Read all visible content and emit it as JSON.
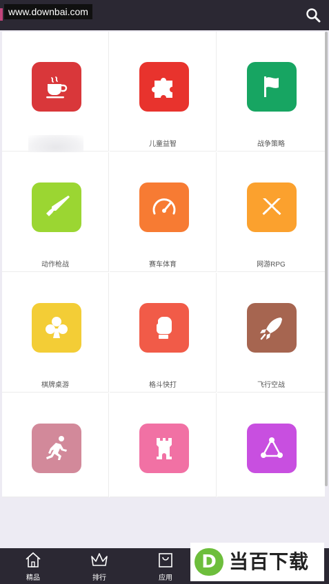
{
  "header": {
    "watermark": "www.downbai.com",
    "search_icon": "search-icon"
  },
  "categories": [
    {
      "label": "",
      "color": "#d9373a",
      "icon": "coffee-cup-icon"
    },
    {
      "label": "儿童益智",
      "color": "#e8332d",
      "icon": "puzzle-icon"
    },
    {
      "label": "战争策略",
      "color": "#17a562",
      "icon": "flag-icon"
    },
    {
      "label": "动作枪战",
      "color": "#9bd632",
      "icon": "rifle-icon"
    },
    {
      "label": "赛车体育",
      "color": "#f77b33",
      "icon": "speedometer-icon"
    },
    {
      "label": "网游RPG",
      "color": "#fba12e",
      "icon": "crossed-swords-icon"
    },
    {
      "label": "棋牌桌游",
      "color": "#f3cd36",
      "icon": "club-icon"
    },
    {
      "label": "格斗快打",
      "color": "#f15b48",
      "icon": "boxing-glove-icon"
    },
    {
      "label": "飞行空战",
      "color": "#a66550",
      "icon": "rocket-icon"
    },
    {
      "label": "",
      "color": "#d2899a",
      "icon": "runner-icon"
    },
    {
      "label": "",
      "color": "#f171a4",
      "icon": "castle-tower-icon"
    },
    {
      "label": "",
      "color": "#c84fe0",
      "icon": "triangle-nodes-icon"
    }
  ],
  "bottom_nav": [
    {
      "label": "精品",
      "icon": "home-icon"
    },
    {
      "label": "排行",
      "icon": "crown-icon"
    },
    {
      "label": "应用",
      "icon": "bag-icon"
    }
  ],
  "brand": {
    "logo_letter": "D",
    "text": "当百下载",
    "color": "#6dbe3c"
  }
}
